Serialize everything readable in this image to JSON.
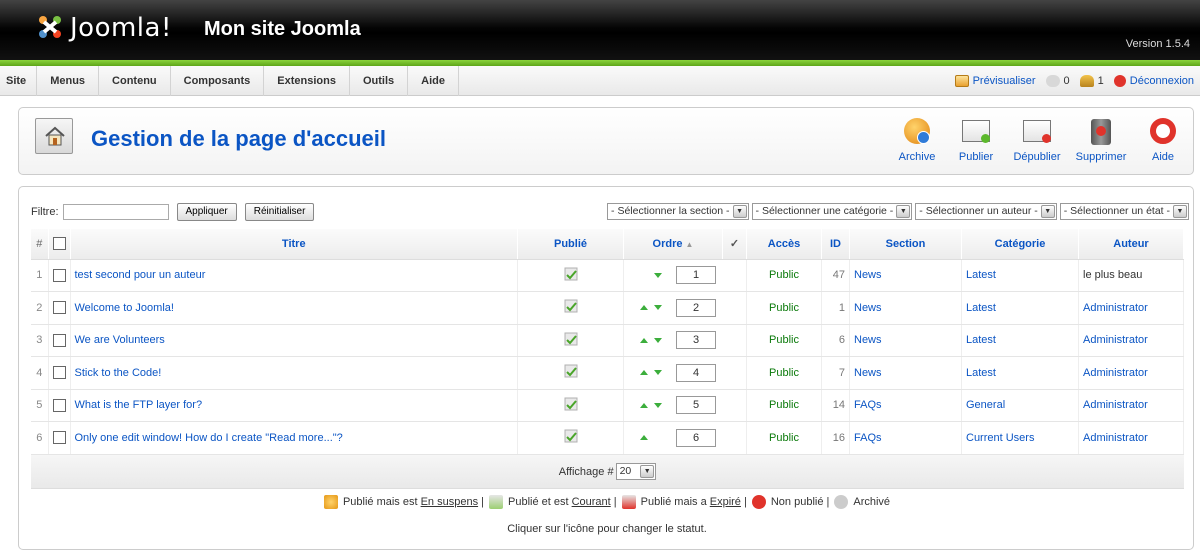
{
  "header": {
    "brand": "Joomla!",
    "site_name": "Mon site Joomla",
    "version": "Version 1.5.4"
  },
  "menu": {
    "items": [
      "Site",
      "Menus",
      "Contenu",
      "Composants",
      "Extensions",
      "Outils",
      "Aide"
    ],
    "preview": "Prévisualiser",
    "messages": "0",
    "users": "1",
    "logout": "Déconnexion"
  },
  "toolbar": {
    "title": "Gestion de la page d'accueil",
    "archive": "Archive",
    "publish": "Publier",
    "unpublish": "Dépublier",
    "delete": "Supprimer",
    "help": "Aide"
  },
  "filter": {
    "label": "Filtre:",
    "value": "",
    "apply": "Appliquer",
    "reset": "Réinitialiser",
    "section": "- Sélectionner la section -",
    "category": "- Sélectionner une catégorie -",
    "author": "- Sélectionner un auteur -",
    "state": "- Sélectionner un état -"
  },
  "columns": {
    "num": "#",
    "title": "Titre",
    "published": "Publié",
    "order": "Ordre",
    "access": "Accès",
    "id": "ID",
    "section": "Section",
    "category": "Catégorie",
    "author": "Auteur"
  },
  "rows": [
    {
      "num": "1",
      "title": "test second pour un auteur",
      "order": "1",
      "access": "Public",
      "id": "47",
      "section": "News",
      "category": "Latest",
      "author": "le plus beau",
      "up": false,
      "down": true,
      "author_link": false
    },
    {
      "num": "2",
      "title": "Welcome to Joomla!",
      "order": "2",
      "access": "Public",
      "id": "1",
      "section": "News",
      "category": "Latest",
      "author": "Administrator",
      "up": true,
      "down": true,
      "author_link": true
    },
    {
      "num": "3",
      "title": "We are Volunteers",
      "order": "3",
      "access": "Public",
      "id": "6",
      "section": "News",
      "category": "Latest",
      "author": "Administrator",
      "up": true,
      "down": true,
      "author_link": true
    },
    {
      "num": "4",
      "title": "Stick to the Code!",
      "order": "4",
      "access": "Public",
      "id": "7",
      "section": "News",
      "category": "Latest",
      "author": "Administrator",
      "up": true,
      "down": true,
      "author_link": true
    },
    {
      "num": "5",
      "title": "What is the FTP layer for?",
      "order": "5",
      "access": "Public",
      "id": "14",
      "section": "FAQs",
      "category": "General",
      "author": "Administrator",
      "up": true,
      "down": true,
      "author_link": true
    },
    {
      "num": "6",
      "title": "Only one edit window! How do I create \"Read more...\"?",
      "order": "6",
      "access": "Public",
      "id": "16",
      "section": "FAQs",
      "category": "Current Users",
      "author": "Administrator",
      "up": true,
      "down": false,
      "author_link": true
    }
  ],
  "pagination": {
    "label": "Affichage #",
    "value": "20"
  },
  "legend": {
    "pending_a": "Publié mais est ",
    "pending_b": "En suspens",
    "current_a": "Publié et est ",
    "current_b": "Courant",
    "expired_a": "Publié mais a ",
    "expired_b": "Expiré",
    "unpublished": "Non publié",
    "archived": "Archivé",
    "sep": "|",
    "hint": "Cliquer sur l'icône pour changer le statut."
  },
  "colors": {
    "link": "#0b55c4",
    "header_bg": "#000000",
    "green_bar": "#6dbb25"
  }
}
